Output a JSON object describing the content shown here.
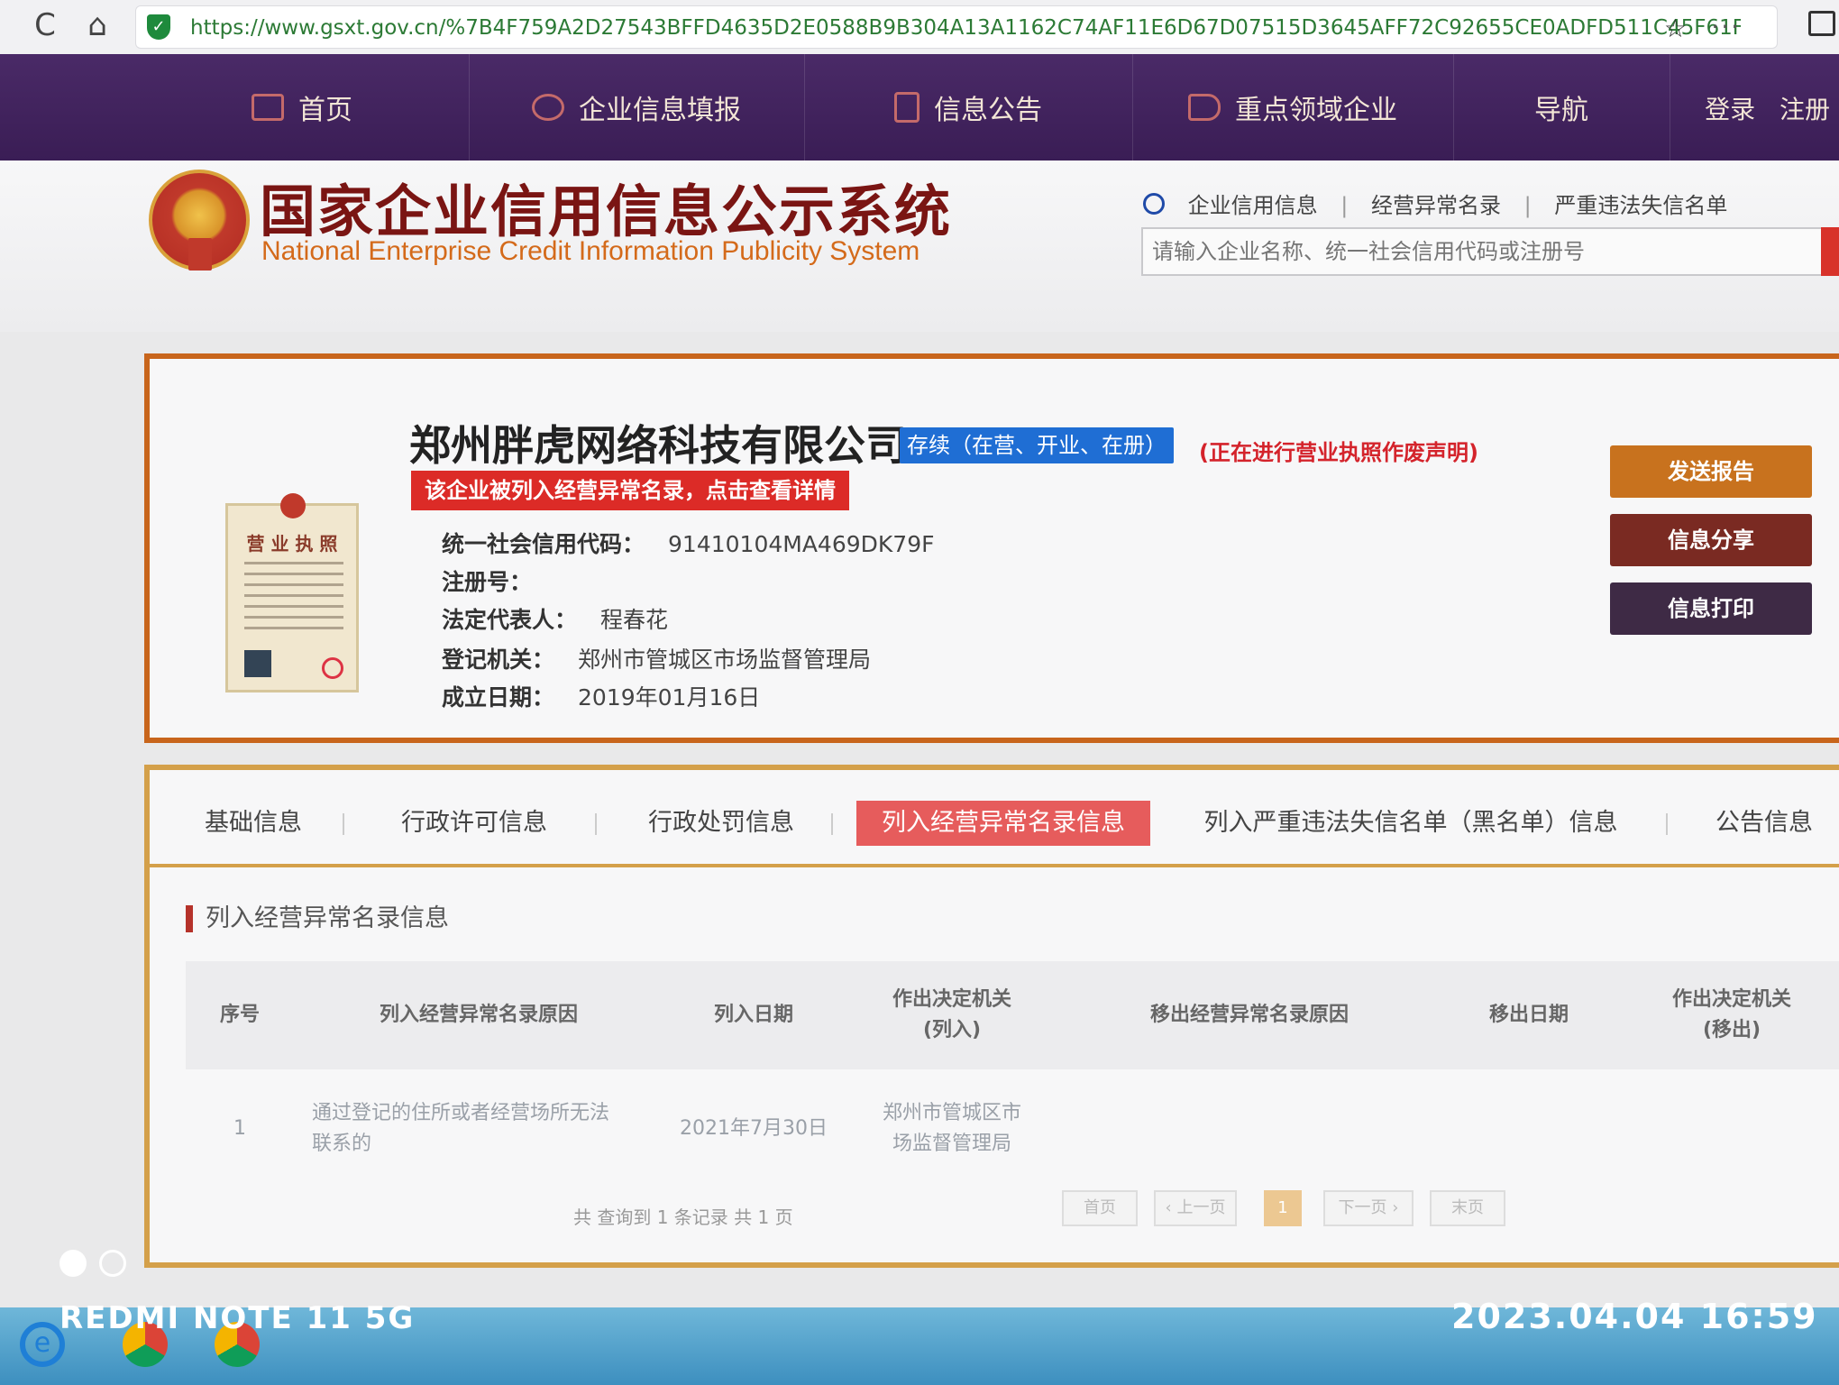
{
  "browser": {
    "url": "https://www.gsxt.gov.cn/%7B4F759A2D27543BFFD4635D2E0588B9B304A13A1162C74AF11E6D67D07515D3645AFF72C92655CE0ADFD511C45F61F",
    "reload_icon": "C",
    "home_icon": "⌂",
    "star_icon": "☆",
    "more_icon": "···"
  },
  "topnav": {
    "items": [
      {
        "label": "首页",
        "icon": "monitor-icon"
      },
      {
        "label": "企业信息填报",
        "icon": "edit-icon"
      },
      {
        "label": "信息公告",
        "icon": "document-icon"
      },
      {
        "label": "重点领域企业",
        "icon": "megaphone-icon"
      },
      {
        "label": "导航",
        "icon": ""
      }
    ],
    "login": "登录",
    "register": "注册"
  },
  "header": {
    "title": "国家企业信用信息公示系统",
    "subtitle": "National Enterprise Credit Information Publicity System",
    "search_links": [
      "企业信用信息",
      "经营异常名录",
      "严重违法失信名单"
    ],
    "search_placeholder": "请输入企业名称、统一社会信用代码或注册号"
  },
  "company": {
    "name": "郑州胖虎网络科技有限公司",
    "status": "存续（在营、开业、在册）",
    "void_notice": "(正在进行营业执照作废声明)",
    "abnormal_alert": "该企业被列入经营异常名录，点击查看详情",
    "license_title": "营 业 执 照",
    "fields": {
      "credit_code_label": "统一社会信用代码：",
      "credit_code": "91410104MA469DK79F",
      "reg_no_label": "注册号：",
      "reg_no": "",
      "legal_rep_label": "法定代表人：",
      "legal_rep": "程春花",
      "authority_label": "登记机关：",
      "authority": "郑州市管城区市场监督管理局",
      "founded_label": "成立日期：",
      "founded": "2019年01月16日"
    },
    "actions": [
      "发送报告",
      "信息分享",
      "信息打印"
    ],
    "action_colors": [
      "#c8721e",
      "#7a2a22",
      "#3e2a45"
    ]
  },
  "tabs": [
    "基础信息",
    "行政许可信息",
    "行政处罚信息",
    "列入经营异常名录信息",
    "列入严重违法失信名单（黑名单）信息",
    "公告信息"
  ],
  "active_tab": 3,
  "abnormal_list": {
    "section_title": "列入经营异常名录信息",
    "headers": [
      "序号",
      "列入经营异常名录原因",
      "列入日期",
      "作出决定机关(列入)",
      "移出经营异常名录原因",
      "移出日期",
      "作出决定机关(移出)"
    ],
    "header_lines": {
      "h3a": "作出决定机关",
      "h3b": "(列入)",
      "h6a": "作出决定机关",
      "h6b": "(移出)"
    },
    "rows": [
      {
        "index": "1",
        "reason_a": "通过登记的住所或者经营场所无法",
        "reason_b": "联系的",
        "date": "2021年7月30日",
        "authority_a": "郑州市管城区市",
        "authority_b": "场监督管理局",
        "removal_reason": "",
        "removal_date": "",
        "removal_authority": ""
      }
    ],
    "pager": {
      "summary": "共 查询到 1 条记录 共 1 页",
      "first": "首页",
      "prev": "‹ 上一页",
      "current": "1",
      "next": "下一页 ›",
      "last": "末页"
    }
  },
  "watermark": {
    "device": "REDMI NOTE 11 5G",
    "datetime": "2023.04.04  16:59"
  }
}
